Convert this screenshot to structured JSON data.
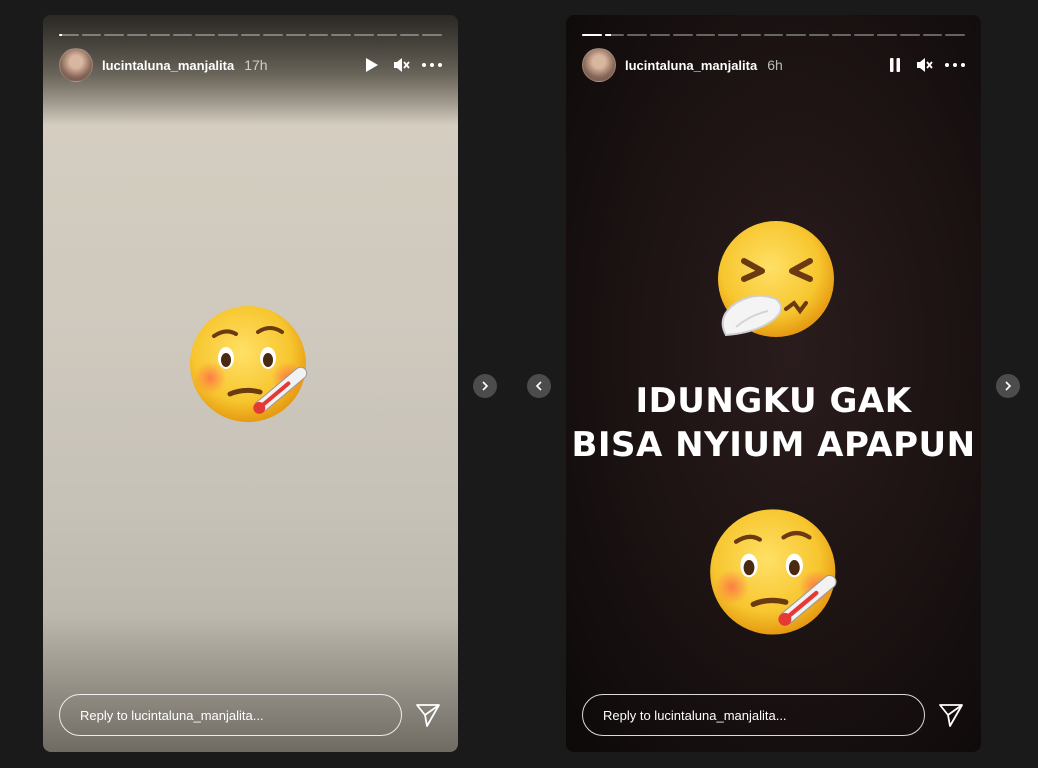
{
  "stories": [
    {
      "username": "lucintaluna_manjalita",
      "time": "17h",
      "segments": 17,
      "active_segment": 0,
      "active_progress": 0.15,
      "playback_state": "play-icon",
      "reply_placeholder": "Reply to lucintaluna_manjalita...",
      "emojis": [
        "face-with-thermometer"
      ]
    },
    {
      "username": "lucintaluna_manjalita",
      "time": "6h",
      "segments": 17,
      "active_segment": 1,
      "active_progress": 0.3,
      "playback_state": "pause-icon",
      "caption_line1": "IDUNGKU GAK",
      "caption_line2": "BISA NYIUM APAPUN",
      "reply_placeholder": "Reply to lucintaluna_manjalita...",
      "emojis": [
        "sneezing-face",
        "face-with-thermometer"
      ]
    }
  ],
  "colors": {
    "background": "#1a1a1a",
    "emoji_yellow": "#f7c62f"
  }
}
